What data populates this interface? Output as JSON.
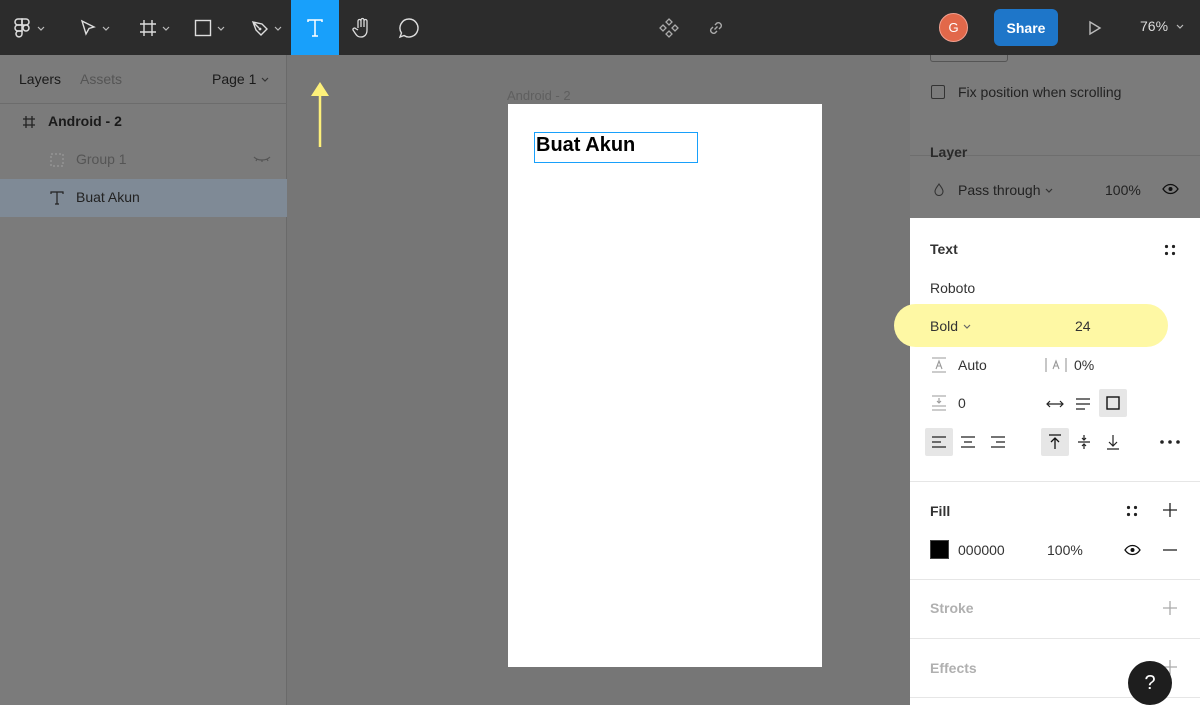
{
  "toolbar": {
    "avatar_initial": "G",
    "share_label": "Share",
    "zoom": "76%"
  },
  "layers_panel": {
    "tabs": [
      "Layers",
      "Assets"
    ],
    "page_selector": "Page 1",
    "items": [
      {
        "label": "Android - 2",
        "icon": "frame-icon"
      },
      {
        "label": "Group 1",
        "icon": "group-icon"
      },
      {
        "label": "Buat Akun",
        "icon": "text-icon"
      }
    ]
  },
  "canvas": {
    "frame_label": "Android - 2",
    "text_content": "Buat Akun"
  },
  "properties": {
    "fix_position_label": "Fix position when scrolling",
    "layer": {
      "title": "Layer",
      "blend_mode": "Pass through",
      "opacity": "100%"
    },
    "text": {
      "title": "Text",
      "font_family": "Roboto",
      "font_weight": "Bold",
      "font_size": "24",
      "line_height": "Auto",
      "letter_spacing": "0%",
      "paragraph_spacing": "0"
    },
    "fill": {
      "title": "Fill",
      "hex": "000000",
      "opacity": "100%",
      "color": "#000000"
    },
    "stroke": {
      "title": "Stroke"
    },
    "effects": {
      "title": "Effects"
    }
  },
  "help_label": "?",
  "colors": {
    "accent": "#18a0fb",
    "share": "#1e76c9",
    "highlight": "#fef8a4"
  }
}
